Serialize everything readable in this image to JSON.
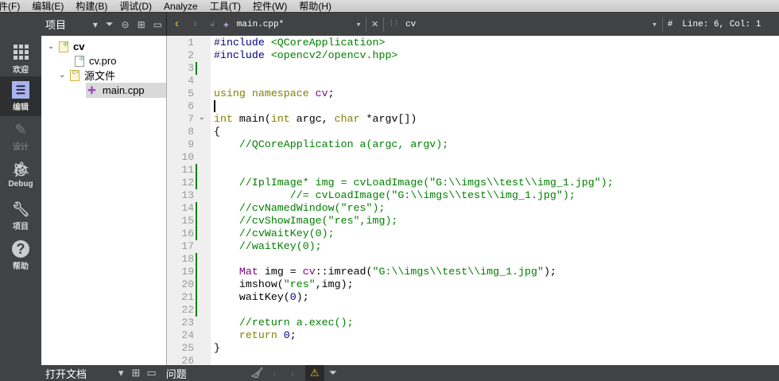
{
  "menu": [
    "文件(F)",
    "编辑(E)",
    "构建(B)",
    "调试(D)",
    "Analyze",
    "工具(T)",
    "控件(W)",
    "帮助(H)"
  ],
  "modes": [
    {
      "label": "欢迎",
      "icon": "grid-icon"
    },
    {
      "label": "编辑",
      "icon": "edit-icon"
    },
    {
      "label": "设计",
      "icon": "pencil-icon"
    },
    {
      "label": "Debug",
      "icon": "bug-icon"
    },
    {
      "label": "项目",
      "icon": "wrench-icon"
    },
    {
      "label": "帮助",
      "icon": "help-icon"
    }
  ],
  "project_panel": {
    "title": "项目",
    "tree": [
      {
        "label": "cv",
        "level": 0
      },
      {
        "label": "cv.pro",
        "level": 1
      },
      {
        "label": "源文件",
        "level": 1
      },
      {
        "label": "main.cpp",
        "level": 2
      }
    ]
  },
  "editor_header": {
    "file": "main.cpp*",
    "symbol": "cv",
    "hash": "#",
    "position": "Line: 6, Col: 1"
  },
  "code": [
    [
      [
        "#include ",
        "pp"
      ],
      [
        "<QCoreApplication>",
        "inc"
      ]
    ],
    [
      [
        "#include ",
        "pp"
      ],
      [
        "<opencv2/opencv.hpp>",
        "inc"
      ]
    ],
    [],
    [],
    [
      [
        "using namespace ",
        "kw"
      ],
      [
        "cv",
        "ns"
      ],
      [
        ";",
        ""
      ]
    ],
    [],
    [
      [
        "int",
        "kw"
      ],
      [
        " main(",
        ""
      ],
      [
        "int",
        "kw"
      ],
      [
        " argc, ",
        ""
      ],
      [
        "char",
        "kw"
      ],
      [
        " *argv[])",
        ""
      ]
    ],
    [
      [
        "{",
        ""
      ]
    ],
    [
      [
        "    //QCoreApplication a(argc, argv);",
        "cm"
      ]
    ],
    [],
    [],
    [
      [
        "    //IplImage* img = cvLoadImage(\"G:\\\\imgs\\\\test\\\\img_1.jpg\");",
        "cm"
      ]
    ],
    [
      [
        "            //= cvLoadImage(\"G:\\\\imgs\\\\test\\\\img_1.jpg\");",
        "cm"
      ]
    ],
    [
      [
        "    //cvNamedWindow(\"res\");",
        "cm"
      ]
    ],
    [
      [
        "    //cvShowImage(\"res\",img);",
        "cm"
      ]
    ],
    [
      [
        "    //cvWaitKey(0);",
        "cm"
      ]
    ],
    [
      [
        "    //waitKey(0);",
        "cm"
      ]
    ],
    [],
    [
      [
        "    ",
        ""
      ],
      [
        "Mat",
        "ty"
      ],
      [
        " img = ",
        ""
      ],
      [
        "cv",
        "ns"
      ],
      [
        "::imread(",
        ""
      ],
      [
        "\"G:\\\\imgs\\\\test\\\\img_1.jpg\"",
        "str"
      ],
      [
        ");",
        ""
      ]
    ],
    [
      [
        "    imshow(",
        ""
      ],
      [
        "\"res\"",
        "str"
      ],
      [
        ",img);",
        ""
      ]
    ],
    [
      [
        "    waitKey(",
        ""
      ],
      [
        "0",
        "num"
      ],
      [
        ");",
        ""
      ]
    ],
    [],
    [
      [
        "    //return a.exec();",
        "cm"
      ]
    ],
    [
      [
        "    ",
        ""
      ],
      [
        "return",
        "kw"
      ],
      [
        " ",
        ""
      ],
      [
        "0",
        "num"
      ],
      [
        ";",
        ""
      ]
    ],
    [
      [
        "}",
        ""
      ]
    ],
    []
  ],
  "changed_lines": [
    3,
    11,
    12,
    14,
    15,
    16,
    18,
    19,
    20,
    21,
    22
  ],
  "bottom": {
    "open_docs": "打开文档",
    "issues": "问题"
  }
}
